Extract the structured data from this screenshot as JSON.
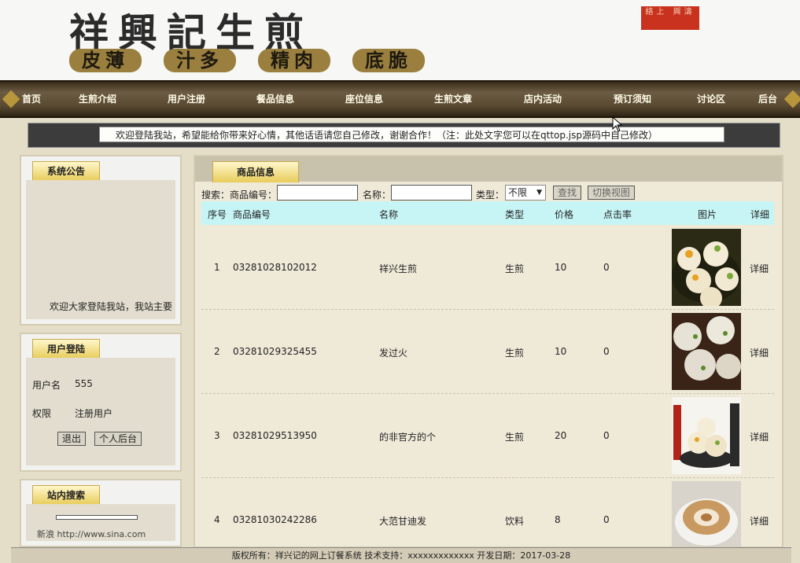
{
  "banner": {
    "title": "祥興記生煎",
    "slogans": [
      "皮薄",
      "汁多",
      "精肉",
      "底脆"
    ],
    "seal": "絡上 興濤"
  },
  "nav": {
    "items": [
      "首页",
      "生煎介绍",
      "用户注册",
      "餐品信息",
      "座位信息",
      "生煎文章",
      "店内活动",
      "预订须知",
      "讨论区",
      "后台"
    ]
  },
  "notice": {
    "text": "欢迎登陆我站，希望能给你带来好心情，其他话语请您自己修改，谢谢合作！（注：此处文字您可以在qttop.jsp源码中自己修改）"
  },
  "announcement": {
    "title": "系统公告",
    "text": "欢迎大家登陆我站，我站主要"
  },
  "login": {
    "title": "用户登陆",
    "username_label": "用户名",
    "username_value": "555",
    "role_label": "权限",
    "role_value": "注册用户",
    "logout_label": "退出",
    "profile_label": "个人后台"
  },
  "site_search": {
    "title": "站内搜索",
    "partial_text": "新浪  http://www.sina.com"
  },
  "main": {
    "tab_title": "商品信息",
    "search": {
      "prefix": "搜索：",
      "code_label": "商品编号：",
      "name_label": "名称：",
      "type_label": "类型：",
      "type_selected": "不限",
      "search_button": "查找",
      "switch_button": "切换视图"
    },
    "columns": [
      "序号",
      "商品编号",
      "名称",
      "类型",
      "价格",
      "点击率",
      "图片",
      "详细"
    ],
    "rows": [
      {
        "index": "1",
        "code": "03281028102012",
        "name": "祥兴生煎",
        "type": "生煎",
        "price": "10",
        "clicks": "0",
        "image": "bun-photo-1",
        "detail": "详细"
      },
      {
        "index": "2",
        "code": "03281029325455",
        "name": "发过火",
        "type": "生煎",
        "price": "10",
        "clicks": "0",
        "image": "bun-photo-2",
        "detail": "详细"
      },
      {
        "index": "3",
        "code": "03281029513950",
        "name": "的非官方的个",
        "type": "生煎",
        "price": "20",
        "clicks": "0",
        "image": "bun-photo-3",
        "detail": "详细"
      },
      {
        "index": "4",
        "code": "03281030242286",
        "name": "大范甘迪发",
        "type": "饮料",
        "price": "8",
        "clicks": "0",
        "image": "coffee-photo",
        "detail": "详细"
      }
    ]
  },
  "footer": {
    "text": "版权所有：祥兴记的网上订餐系统 技术支持：xxxxxxxxxxxxx 开发日期：2017-03-28"
  },
  "colors": {
    "header_bg": "#c7f5f5",
    "tab_gold": "#e8cc5a",
    "nav_brown": "#5a4a32"
  }
}
